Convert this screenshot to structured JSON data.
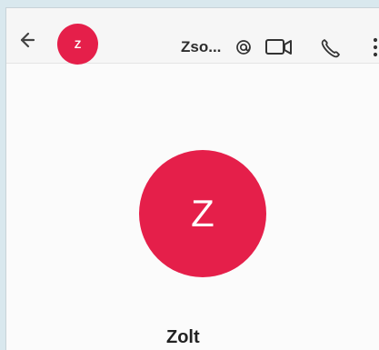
{
  "topbar": {
    "back_icon": "arrow-left-icon",
    "avatar_letter": "Z",
    "contact_name_short": "Zso...",
    "at_icon": "at-icon",
    "video_icon": "video-camera-icon",
    "phone_icon": "phone-icon",
    "more_icon": "more-vertical-icon"
  },
  "profile": {
    "avatar_letter": "Z",
    "name": "Zolt"
  },
  "colors": {
    "avatar_bg": "#e51f4a",
    "header_bg": "#f6f6f6",
    "page_bg": "#fbfbfb"
  }
}
